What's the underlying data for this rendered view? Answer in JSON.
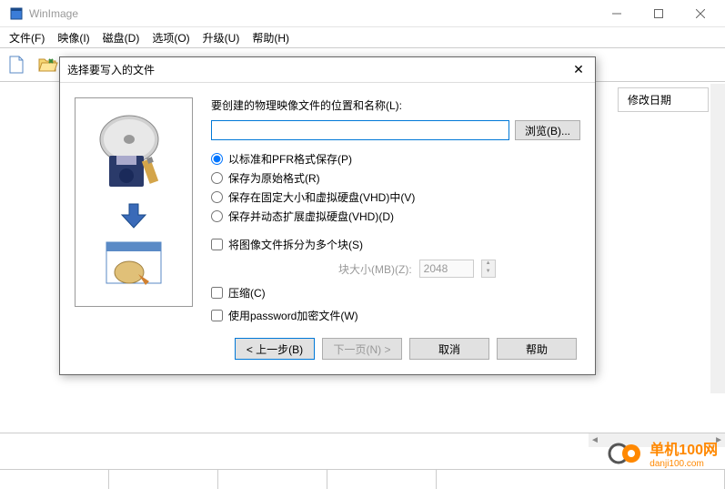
{
  "window": {
    "title": "WinImage"
  },
  "menu": {
    "file": "文件(F)",
    "image": "映像(I)",
    "disk": "磁盘(D)",
    "options": "选项(O)",
    "upgrade": "升级(U)",
    "help": "帮助(H)"
  },
  "column": {
    "modified": "修改日期"
  },
  "dialog": {
    "title": "选择要写入的文件",
    "location_label": "要创建的物理映像文件的位置和名称(L):",
    "path_value": "",
    "browse": "浏览(B)...",
    "radio": {
      "standard_pfr": "以标准和PFR格式保存(P)",
      "original": "保存为原始格式(R)",
      "fixed_vhd": "保存在固定大小和虚拟硬盘(VHD)中(V)",
      "dynamic_vhd": "保存并动态扩展虚拟硬盘(VHD)(D)"
    },
    "check": {
      "split": "将图像文件拆分为多个块(S)",
      "compress": "压缩(C)",
      "encrypt": "使用password加密文件(W)"
    },
    "block_size_label": "块大小(MB)(Z):",
    "block_size_value": "2048",
    "buttons": {
      "back": "< 上一步(B)",
      "next": "下一页(N) >",
      "cancel": "取消",
      "help": "帮助"
    }
  },
  "watermark": {
    "main": "单机100网",
    "sub": "danji100.com"
  }
}
